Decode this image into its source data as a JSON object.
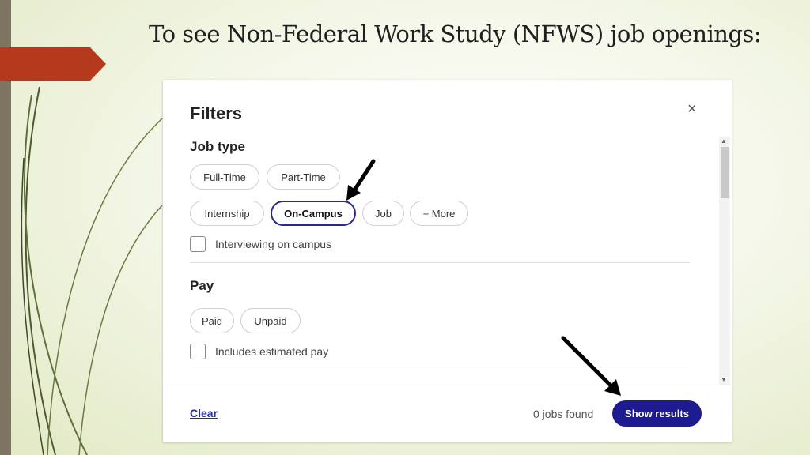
{
  "slide": {
    "title": "To see Non-Federal Work Study (NFWS) job openings:"
  },
  "panel": {
    "title": "Filters",
    "close_symbol": "×",
    "job_type": {
      "heading": "Job type",
      "chips": [
        "Full-Time",
        "Part-Time",
        "Internship",
        "On-Campus",
        "Job",
        "+ More"
      ],
      "selected": "On-Campus",
      "checkbox_label": "Interviewing on campus"
    },
    "pay": {
      "heading": "Pay",
      "chips": [
        "Paid",
        "Unpaid"
      ],
      "checkbox_label": "Includes estimated pay"
    },
    "footer": {
      "clear_label": "Clear",
      "jobs_found": "0 jobs found",
      "show_results_label": "Show results"
    }
  },
  "colors": {
    "accent": "#b5391c",
    "primary_button": "#1d1b8f",
    "selected_chip_border": "#2b2a8c",
    "link": "#1f2bb3"
  },
  "icons": [
    "close-icon",
    "pointer-arrow-icon",
    "scroll-up-icon",
    "scroll-down-icon"
  ]
}
